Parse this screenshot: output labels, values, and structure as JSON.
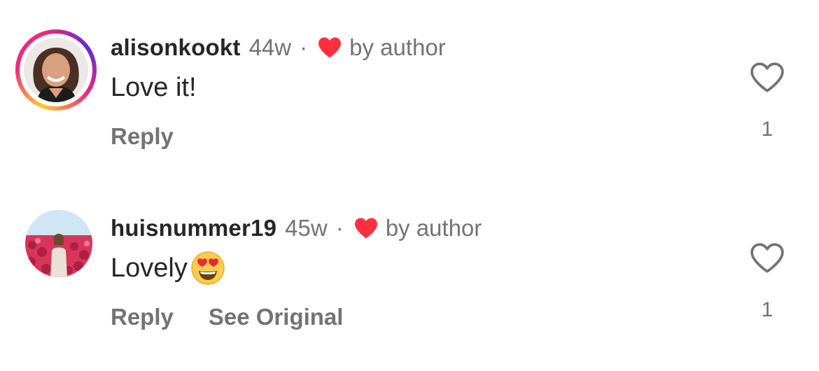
{
  "comments": [
    {
      "username": "alisonkookt",
      "time": "44w",
      "separator": "·",
      "by_author": "by author",
      "text": "Love it!",
      "reply_label": "Reply",
      "like_count": "1",
      "has_story_ring": true
    },
    {
      "username": "huisnummer19",
      "time": "45w",
      "separator": "·",
      "by_author": "by author",
      "text": "Lovely",
      "emoji": "heart-eyes-emoji",
      "reply_label": "Reply",
      "see_original_label": "See Original",
      "like_count": "1",
      "has_story_ring": false
    }
  ],
  "icons": {
    "author_like": "red-heart-icon",
    "like": "heart-outline-icon"
  },
  "colors": {
    "author_heart": "#ff2f40",
    "text_primary": "#262626",
    "text_secondary": "#737373"
  }
}
